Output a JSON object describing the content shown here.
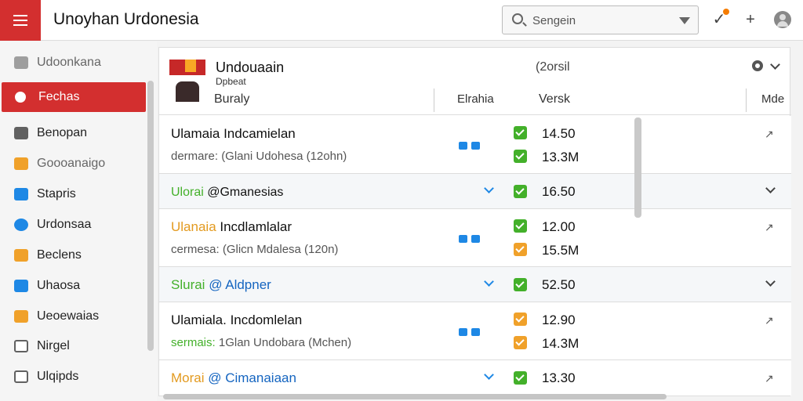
{
  "app": {
    "title": "Unoyhan Urdonesia",
    "accent": "#d32f2f"
  },
  "search": {
    "placeholder": "Sengein",
    "icon": "search-icon",
    "dropdown_icon": "triangle-down-icon"
  },
  "topbar_icons": [
    "pin-icon",
    "plus-icon",
    "avatar"
  ],
  "sidebar": {
    "items": [
      {
        "label": "Udoonkana",
        "icon": "doc-icon",
        "color": "#9e9e9e"
      },
      {
        "label": "Fechas",
        "icon": "gear-icon",
        "color": "#ffffff",
        "active": true
      },
      {
        "label": "Benopan",
        "icon": "folder-icon",
        "color": "#616161"
      },
      {
        "label": "Goooanaigo",
        "icon": "box-icon",
        "color": "#f0a12a"
      },
      {
        "label": "Stapris",
        "icon": "image-icon",
        "color": "#1e88e5"
      },
      {
        "label": "Urdonsaa",
        "icon": "globe-icon",
        "color": "#1e88e5"
      },
      {
        "label": "Beclens",
        "icon": "calendar-icon",
        "color": "#f0a12a"
      },
      {
        "label": "Uhaosa",
        "icon": "window-icon",
        "color": "#1e88e5"
      },
      {
        "label": "Ueoewaias",
        "icon": "star-icon",
        "color": "#f0a12a"
      },
      {
        "label": "Nirgel",
        "icon": "doc-icon",
        "color": "#616161"
      },
      {
        "label": "Ulqipds",
        "icon": "doc-icon",
        "color": "#616161"
      }
    ]
  },
  "panel": {
    "header": {
      "title": "Undouaain",
      "subtitle": "Dpbeat",
      "col1": "Buraly",
      "col2": "Elrahia",
      "col3": "Versk",
      "col4": "Mde",
      "count": "(2orsil"
    },
    "rows": [
      {
        "type": "full",
        "title": "Ulamaia  Indcamielan",
        "title_color": "#111111",
        "sub": "dermare: (Glani Udohesa (12ohn)",
        "sub_color": "#555555",
        "checks": [
          "green",
          "green"
        ],
        "values": [
          "14.50",
          "13.3M"
        ]
      },
      {
        "type": "compact",
        "prefix": "Ulorai",
        "prefix_color": "#43b02a",
        "rest": " @Gmanesias",
        "check": "green",
        "value": "16.50"
      },
      {
        "type": "full",
        "title_prefix": "Ulanaia",
        "title_prefix_color": "#e39a1f",
        "title_rest": "  Incdlamlalar",
        "sub": "cermesa: (Glicn Mdalesa (120n)",
        "sub_color": "#555555",
        "checks": [
          "green",
          "orange"
        ],
        "values": [
          "12.00",
          "15.5M"
        ]
      },
      {
        "type": "compact",
        "prefix": "Slurai",
        "prefix_color": "#43b02a",
        "rest": " @ Aldpner",
        "check": "green",
        "value": "52.50"
      },
      {
        "type": "full",
        "title": "Ulamiala. Incdomlelan",
        "title_color": "#111111",
        "sub_prefix": "sermais:",
        "sub_prefix_color": "#43b02a",
        "sub_rest": " 1Glan Undobara (Mchen)",
        "checks": [
          "orange",
          "orange"
        ],
        "values": [
          "12.90",
          "14.3M"
        ]
      },
      {
        "type": "compact",
        "prefix": "Morai",
        "prefix_color": "#e39a1f",
        "rest": " @ Cimanaiaan",
        "check": "green",
        "value": "13.30"
      }
    ]
  }
}
